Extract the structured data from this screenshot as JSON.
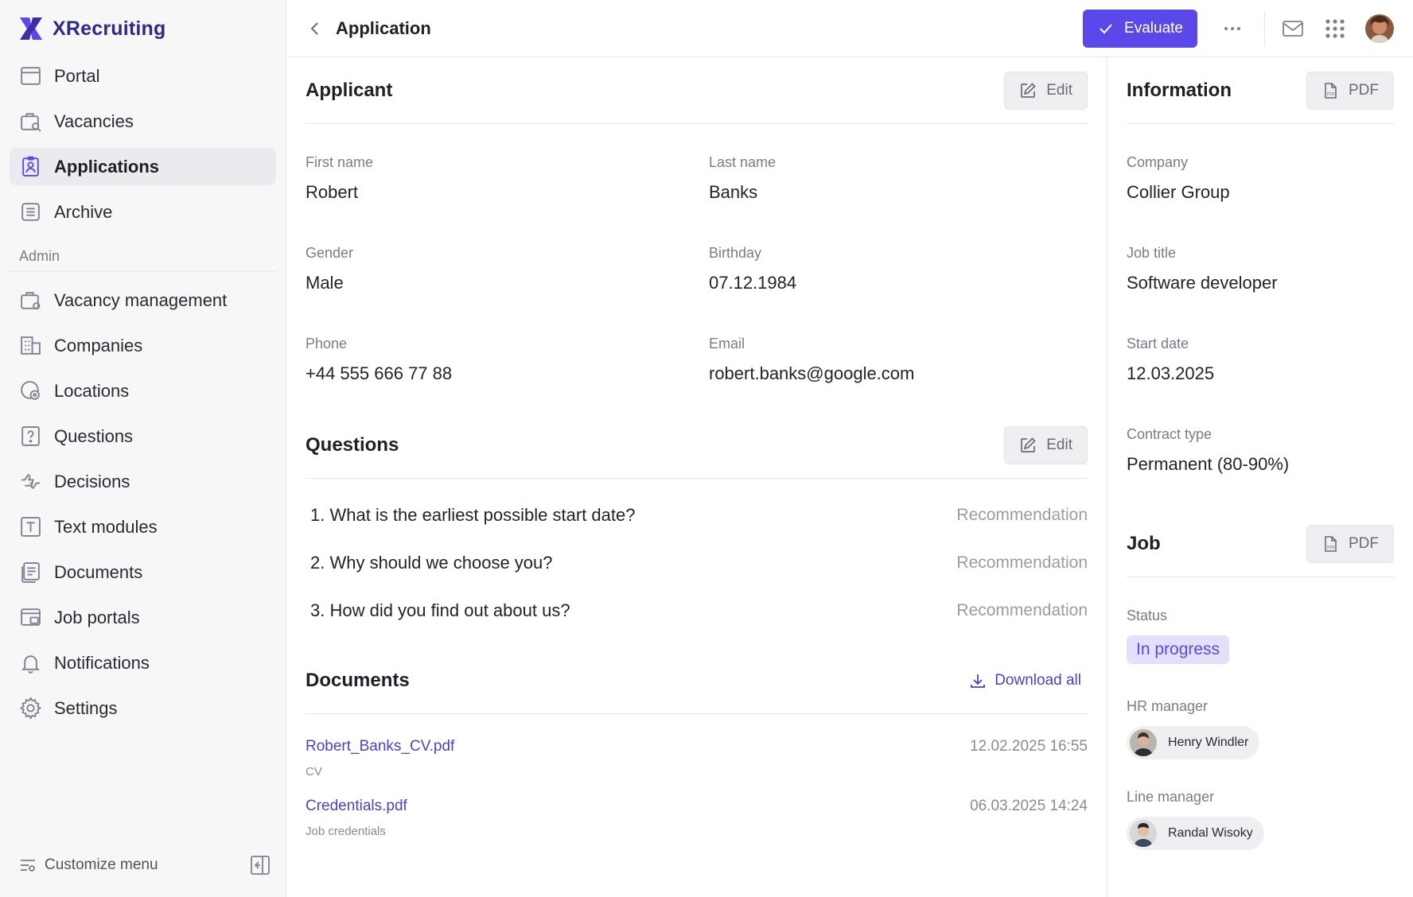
{
  "brand": {
    "name": "XRecruiting"
  },
  "nav": {
    "items": [
      {
        "label": "Portal",
        "icon": "portal-icon"
      },
      {
        "label": "Vacancies",
        "icon": "vacancies-icon"
      },
      {
        "label": "Applications",
        "icon": "applications-icon",
        "active": true
      },
      {
        "label": "Archive",
        "icon": "archive-icon"
      }
    ],
    "admin_label": "Admin",
    "admin_items": [
      {
        "label": "Vacancy management",
        "icon": "vacancy-management-icon"
      },
      {
        "label": "Companies",
        "icon": "companies-icon"
      },
      {
        "label": "Locations",
        "icon": "locations-icon"
      },
      {
        "label": "Questions",
        "icon": "questions-icon"
      },
      {
        "label": "Decisions",
        "icon": "decisions-icon"
      },
      {
        "label": "Text modules",
        "icon": "text-modules-icon"
      },
      {
        "label": "Documents",
        "icon": "documents-icon"
      },
      {
        "label": "Job portals",
        "icon": "job-portals-icon"
      },
      {
        "label": "Notifications",
        "icon": "bell-icon"
      },
      {
        "label": "Settings",
        "icon": "gear-icon"
      }
    ],
    "customize_label": "Customize menu"
  },
  "topbar": {
    "title": "Application",
    "evaluate_label": "Evaluate"
  },
  "applicant": {
    "title": "Applicant",
    "edit_label": "Edit",
    "fields": {
      "first_name": {
        "label": "First name",
        "value": "Robert"
      },
      "last_name": {
        "label": "Last name",
        "value": "Banks"
      },
      "gender": {
        "label": "Gender",
        "value": "Male"
      },
      "birthday": {
        "label": "Birthday",
        "value": "07.12.1984"
      },
      "phone": {
        "label": "Phone",
        "value": "+44 555 666 77 88"
      },
      "email": {
        "label": "Email",
        "value": "robert.banks@google.com"
      }
    }
  },
  "questions": {
    "title": "Questions",
    "edit_label": "Edit",
    "items": [
      {
        "text": "1. What is the earliest possible start date?",
        "action": "Recommendation"
      },
      {
        "text": "2. Why should we choose you?",
        "action": "Recommendation"
      },
      {
        "text": "3. How did you find out about us?",
        "action": "Recommendation"
      }
    ]
  },
  "documents": {
    "title": "Documents",
    "download_label": "Download all",
    "items": [
      {
        "name": "Robert_Banks_CV.pdf",
        "type": "CV",
        "date": "12.02.2025 16:55"
      },
      {
        "name": "Credentials.pdf",
        "type": "Job credentials",
        "date": "06.03.2025 14:24"
      }
    ]
  },
  "information": {
    "title": "Information",
    "pdf_label": "PDF",
    "fields": {
      "company": {
        "label": "Company",
        "value": "Collier Group"
      },
      "job_title": {
        "label": "Job title",
        "value": "Software developer"
      },
      "start_date": {
        "label": "Start date",
        "value": "12.03.2025"
      },
      "contract_type": {
        "label": "Contract type",
        "value": "Permanent (80-90%)"
      }
    }
  },
  "job": {
    "title": "Job",
    "pdf_label": "PDF",
    "status": {
      "label": "Status",
      "value": "In progress"
    },
    "hr_manager": {
      "label": "HR manager",
      "name": "Henry Windler"
    },
    "line_manager": {
      "label": "Line manager",
      "name": "Randal Wisoky"
    }
  },
  "colors": {
    "accent": "#5b48ea",
    "link": "#4b3ed6",
    "badge_bg": "#e3e0fb"
  }
}
